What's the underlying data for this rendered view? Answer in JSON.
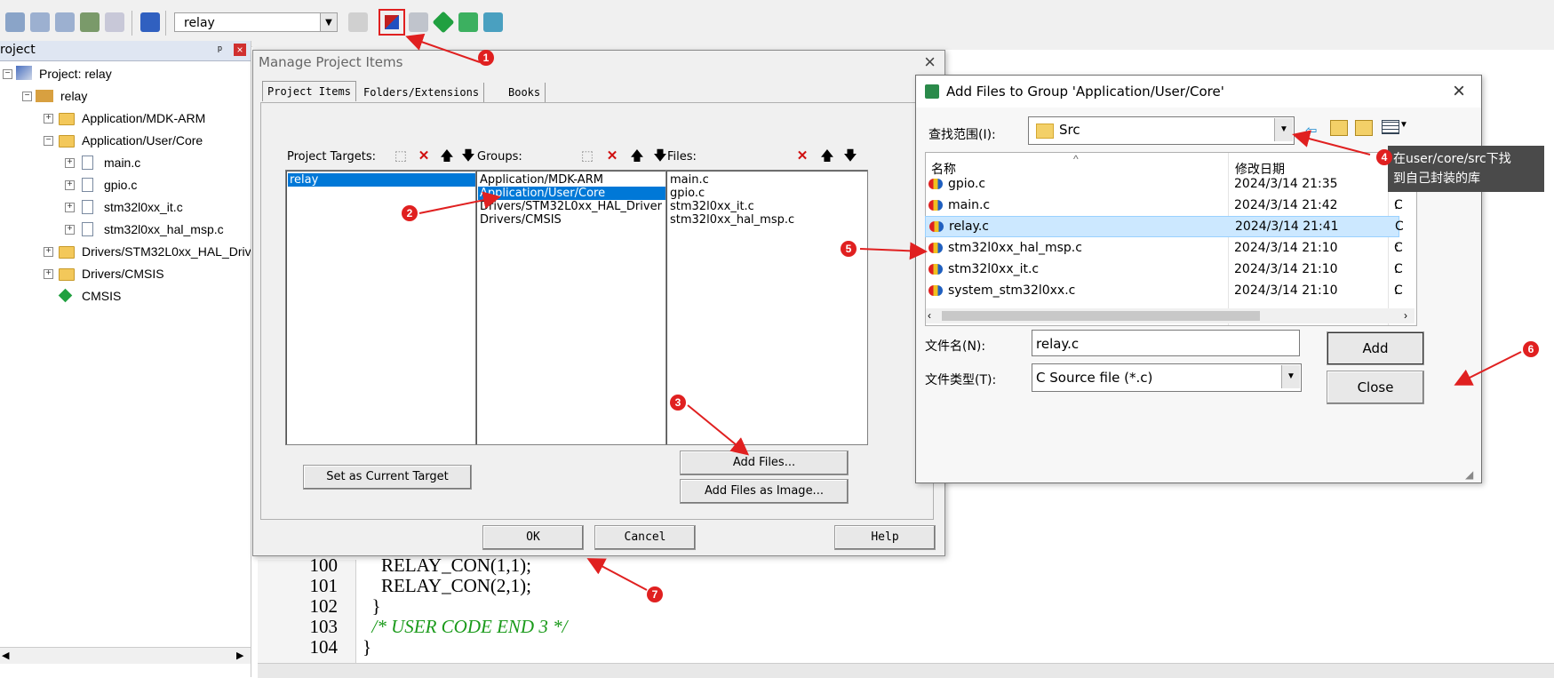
{
  "toolbar": {
    "target_select": "relay"
  },
  "project_panel": {
    "title": "roject",
    "pin": "ᵖ",
    "close": "×",
    "tree": [
      {
        "label": "Project: relay",
        "level": 0
      },
      {
        "label": "relay",
        "level": 1
      },
      {
        "label": "Application/MDK-ARM",
        "level": 2
      },
      {
        "label": "Application/User/Core",
        "level": 2
      },
      {
        "label": "main.c",
        "level": 3
      },
      {
        "label": "gpio.c",
        "level": 3
      },
      {
        "label": "stm32l0xx_it.c",
        "level": 3
      },
      {
        "label": "stm32l0xx_hal_msp.c",
        "level": 3
      },
      {
        "label": "Drivers/STM32L0xx_HAL_Driv",
        "level": 2
      },
      {
        "label": "Drivers/CMSIS",
        "level": 2
      },
      {
        "label": "CMSIS",
        "level": 2
      }
    ]
  },
  "editor": {
    "lines": [
      {
        "num": "100",
        "code": "    RELAY_CON(1,1);"
      },
      {
        "num": "101",
        "code": "    RELAY_CON(2,1);"
      },
      {
        "num": "102",
        "code": "  }"
      },
      {
        "num": "103",
        "code": "  /* USER CODE END 3 */"
      },
      {
        "num": "104",
        "code": "}"
      }
    ]
  },
  "manage_dialog": {
    "title": "Manage Project Items",
    "close": "×",
    "tabs": [
      "Project Items",
      "Folders/Extensions",
      "Books"
    ],
    "targets_label": "Project Targets:",
    "groups_label": "Groups:",
    "files_label": "Files:",
    "targets": [
      "relay"
    ],
    "groups": [
      "Application/MDK-ARM",
      "Application/User/Core",
      "Drivers/STM32L0xx_HAL_Driver",
      "Drivers/CMSIS"
    ],
    "files": [
      "main.c",
      "gpio.c",
      "stm32l0xx_it.c",
      "stm32l0xx_hal_msp.c"
    ],
    "set_current_target": "Set as Current Target",
    "add_files": "Add Files...",
    "add_files_image": "Add Files as Image...",
    "ok": "OK",
    "cancel": "Cancel",
    "help": "Help"
  },
  "add_dialog": {
    "title": "Add Files to Group 'Application/User/Core'",
    "close": "×",
    "look_in_label": "查找范围(I):",
    "look_in_value": "Src",
    "col_name": "名称",
    "col_date": "修改日期",
    "files": [
      {
        "name": "gpio.c",
        "date": "2024/3/14 21:35",
        "type": "C :"
      },
      {
        "name": "main.c",
        "date": "2024/3/14 21:42",
        "type": "C :"
      },
      {
        "name": "relay.c",
        "date": "2024/3/14 21:41",
        "type": "C :"
      },
      {
        "name": "stm32l0xx_hal_msp.c",
        "date": "2024/3/14 21:10",
        "type": "C :"
      },
      {
        "name": "stm32l0xx_it.c",
        "date": "2024/3/14 21:10",
        "type": "C :"
      },
      {
        "name": "system_stm32l0xx.c",
        "date": "2024/3/14 21:10",
        "type": "C :"
      }
    ],
    "filename_label": "文件名(N):",
    "filename_value": "relay.c",
    "filetype_label": "文件类型(T):",
    "filetype_value": "C Source file (*.c)",
    "add": "Add",
    "close_btn": "Close"
  },
  "annotations": {
    "n1": "1",
    "n2": "2",
    "n3": "3",
    "n4": "4",
    "n5": "5",
    "n6": "6",
    "n7": "7",
    "tooltip_line1": "在user/core/src下找",
    "tooltip_line2": "到自己封装的库"
  },
  "colors": {
    "selection": "#0078d7",
    "callout": "#e02020",
    "comment": "#1a9a1a"
  }
}
